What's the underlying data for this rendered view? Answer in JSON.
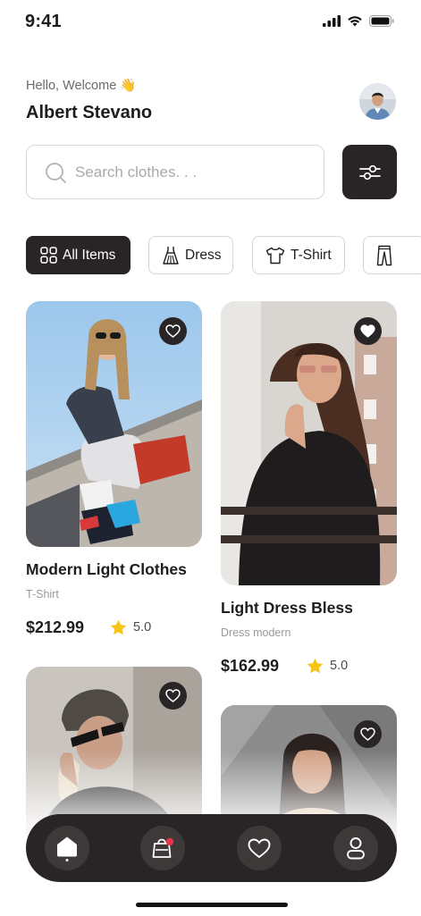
{
  "status_bar": {
    "time": "9:41"
  },
  "header": {
    "greeting": "Hello, Welcome 👋",
    "user_name": "Albert Stevano"
  },
  "search": {
    "placeholder": "Search clothes. . ."
  },
  "categories": [
    {
      "label": "All Items",
      "icon": "grid-icon",
      "active": true
    },
    {
      "label": "Dress",
      "icon": "dress-icon",
      "active": false
    },
    {
      "label": "T-Shirt",
      "icon": "tshirt-icon",
      "active": false
    },
    {
      "label": "",
      "icon": "pants-icon",
      "active": false
    }
  ],
  "products": [
    {
      "title": "Modern Light Clothes",
      "subtitle": "T-Shirt",
      "price": "$212.99",
      "rating": "5.0",
      "favorite_icon": "heart-outline-icon"
    },
    {
      "title": "Light Dress Bless",
      "subtitle": "Dress modern",
      "price": "$162.99",
      "rating": "5.0",
      "favorite_icon": "heart-filled-icon"
    },
    {
      "title": "",
      "subtitle": "",
      "price": "",
      "rating": "",
      "favorite_icon": "heart-outline-icon"
    },
    {
      "title": "",
      "subtitle": "",
      "price": "",
      "rating": "",
      "favorite_icon": "heart-outline-icon"
    }
  ],
  "bottom_nav": [
    {
      "name": "home",
      "icon": "home-icon",
      "active": true
    },
    {
      "name": "cart",
      "icon": "shopping-bag-icon",
      "badge": true
    },
    {
      "name": "favorites",
      "icon": "heart-icon"
    },
    {
      "name": "profile",
      "icon": "user-icon"
    }
  ],
  "colors": {
    "primary_dark": "#292526",
    "star": "#F5C518",
    "badge": "#E8344A",
    "muted_text": "#9a9a9a"
  }
}
